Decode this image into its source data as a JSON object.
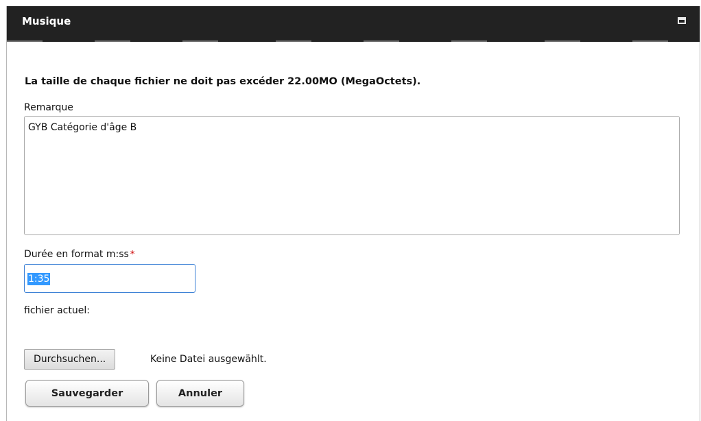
{
  "window": {
    "title": "Musique",
    "maximize_icon": "maximize-icon"
  },
  "form": {
    "notice": "La taille de chaque fichier ne doit pas excéder 22.00MO (MegaOctets).",
    "remark_label": "Remarque",
    "remark_value": "GYB Catégorie d'âge B",
    "duration_label": "Durée en format m:ss",
    "required_marker": "*",
    "duration_value": "1:35",
    "current_file_label": "fichier actuel:",
    "browse_button": "Durchsuchen...",
    "no_file_text": "Keine Datei ausgewählt.",
    "save_button": "Sauvegarder",
    "cancel_button": "Annuler"
  },
  "colors": {
    "titlebar": "#222222",
    "required": "#cc0000",
    "selection": "#3399ff",
    "focus_border": "#3a7fd5"
  }
}
